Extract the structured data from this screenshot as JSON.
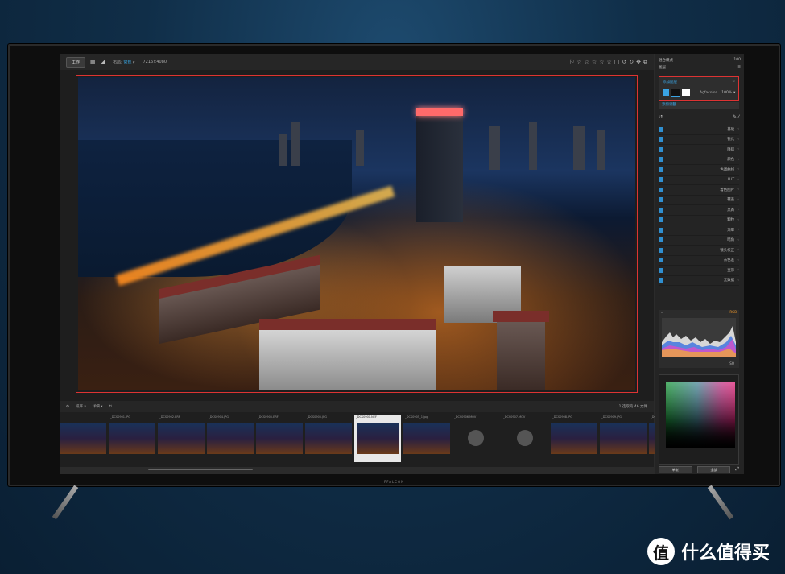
{
  "toolbar": {
    "mode_button": "工作",
    "view_label": "布局",
    "view_value": "常规",
    "dimensions": "7216×4080"
  },
  "filmbar": {
    "sort_label": "排序",
    "view_label": "详细",
    "selection_status": "1 选取的 46 文件"
  },
  "thumbnails": [
    {
      "caption": ""
    },
    {
      "caption": "_DCS0901.JPG"
    },
    {
      "caption": "_DCS0902.ERF"
    },
    {
      "caption": "_DCS0904.JPG"
    },
    {
      "caption": "_DCS0905.ERF"
    },
    {
      "caption": "_DCS0905.JPG"
    },
    {
      "caption": "_DCS0901.NEF",
      "selected": true
    },
    {
      "caption": "_DCS0905_1.jpg"
    },
    {
      "caption": "_DCS0906.MOV",
      "placeholder": true
    },
    {
      "caption": "_DCS0907.MOV",
      "placeholder": true
    },
    {
      "caption": "_DCS0908.JPG"
    },
    {
      "caption": "_DCS0909.JPG"
    },
    {
      "caption": "_DCS"
    }
  ],
  "panel": {
    "opacity_label": "混合模式",
    "opacity_value": "100",
    "blend_label": "图层",
    "layer_title": "添加图层",
    "layer_name": "Agfacolor...",
    "layer_opacity": "100%",
    "add_layer": "添加调整...",
    "adjustments": [
      "基础",
      "锐化",
      "降噪",
      "颜色",
      "色调曲线",
      "LUT",
      "着色图片",
      "覆盖",
      "黑白",
      "颗粒",
      "渐晕",
      "暗角",
      "镜头校正",
      "去色差",
      "变形",
      "元数据"
    ],
    "histogram_tag": "RGB",
    "histogram_foot": "ISO",
    "btn_left": "单张",
    "btn_right": "全部"
  },
  "brand": {
    "bezel": "FFALCON",
    "watermark_icon": "值",
    "watermark_text": "什么值得买"
  },
  "colors": {
    "accent": "#37a4e0",
    "highlight": "#dd3333"
  }
}
